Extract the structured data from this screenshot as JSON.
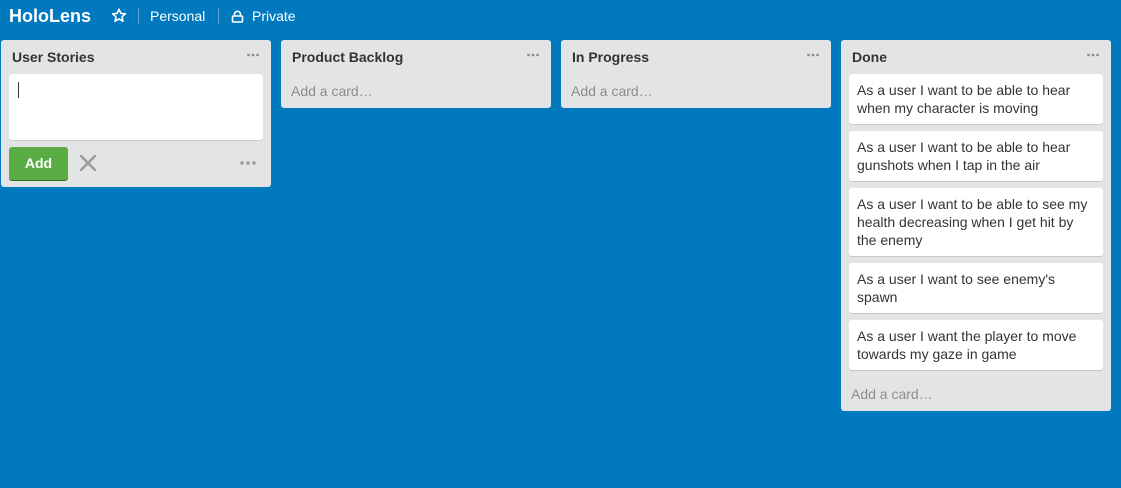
{
  "header": {
    "board_title": "HoloLens",
    "team": "Personal",
    "visibility": "Private"
  },
  "lists": [
    {
      "title": "User Stories",
      "composer_value": "",
      "add_label": "Add"
    },
    {
      "title": "Product Backlog",
      "add_card_label": "Add a card…"
    },
    {
      "title": "In Progress",
      "add_card_label": "Add a card…"
    },
    {
      "title": "Done",
      "cards": [
        "As a user I want to be able to hear when my character is moving",
        "As a user I want to be able to hear gunshots when I tap in the air",
        "As a user I want to be able to see my health decreasing when I get hit by the enemy",
        "As a user I want to see enemy's spawn",
        "As a user I want the player to move towards my gaze in game"
      ],
      "add_card_label": "Add a card…"
    }
  ],
  "colors": {
    "board_background": "#0079bf",
    "list_background": "#e2e4e6",
    "add_button": "#5aac44"
  }
}
